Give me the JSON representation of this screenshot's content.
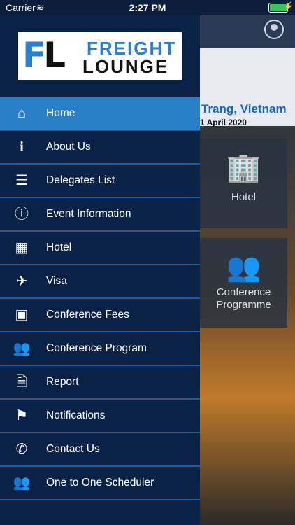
{
  "status_bar": {
    "carrier": "Carrier",
    "time": "2:27 PM"
  },
  "logo": {
    "word1": "FREIGHT",
    "word2": "LOUNGE",
    "mark": "FL"
  },
  "menu": [
    {
      "label": "Home",
      "icon": "home-icon",
      "active": true
    },
    {
      "label": "About Us",
      "icon": "info-small-icon"
    },
    {
      "label": "Delegates List",
      "icon": "list-icon"
    },
    {
      "label": "Event Information",
      "icon": "info-circle-icon"
    },
    {
      "label": "Hotel",
      "icon": "building-icon"
    },
    {
      "label": "Visa",
      "icon": "plane-icon"
    },
    {
      "label": "Conference Fees",
      "icon": "money-icon"
    },
    {
      "label": "Conference Program",
      "icon": "group-icon"
    },
    {
      "label": "Report",
      "icon": "document-icon"
    },
    {
      "label": "Notifications",
      "icon": "flag-icon"
    },
    {
      "label": "Contact Us",
      "icon": "phone-icon"
    },
    {
      "label": "One to One Scheduler",
      "icon": "group-icon"
    }
  ],
  "background": {
    "banner_city": "Trang, Vietnam",
    "banner_date": "1 April 2020",
    "tile_hotel": "Hotel",
    "tile_conference": "Conference Programme"
  },
  "colors": {
    "drawer": "#0b2247",
    "active": "#2a80c8",
    "divider": "#1f5a9e",
    "brand_blue": "#2a7fd1"
  }
}
